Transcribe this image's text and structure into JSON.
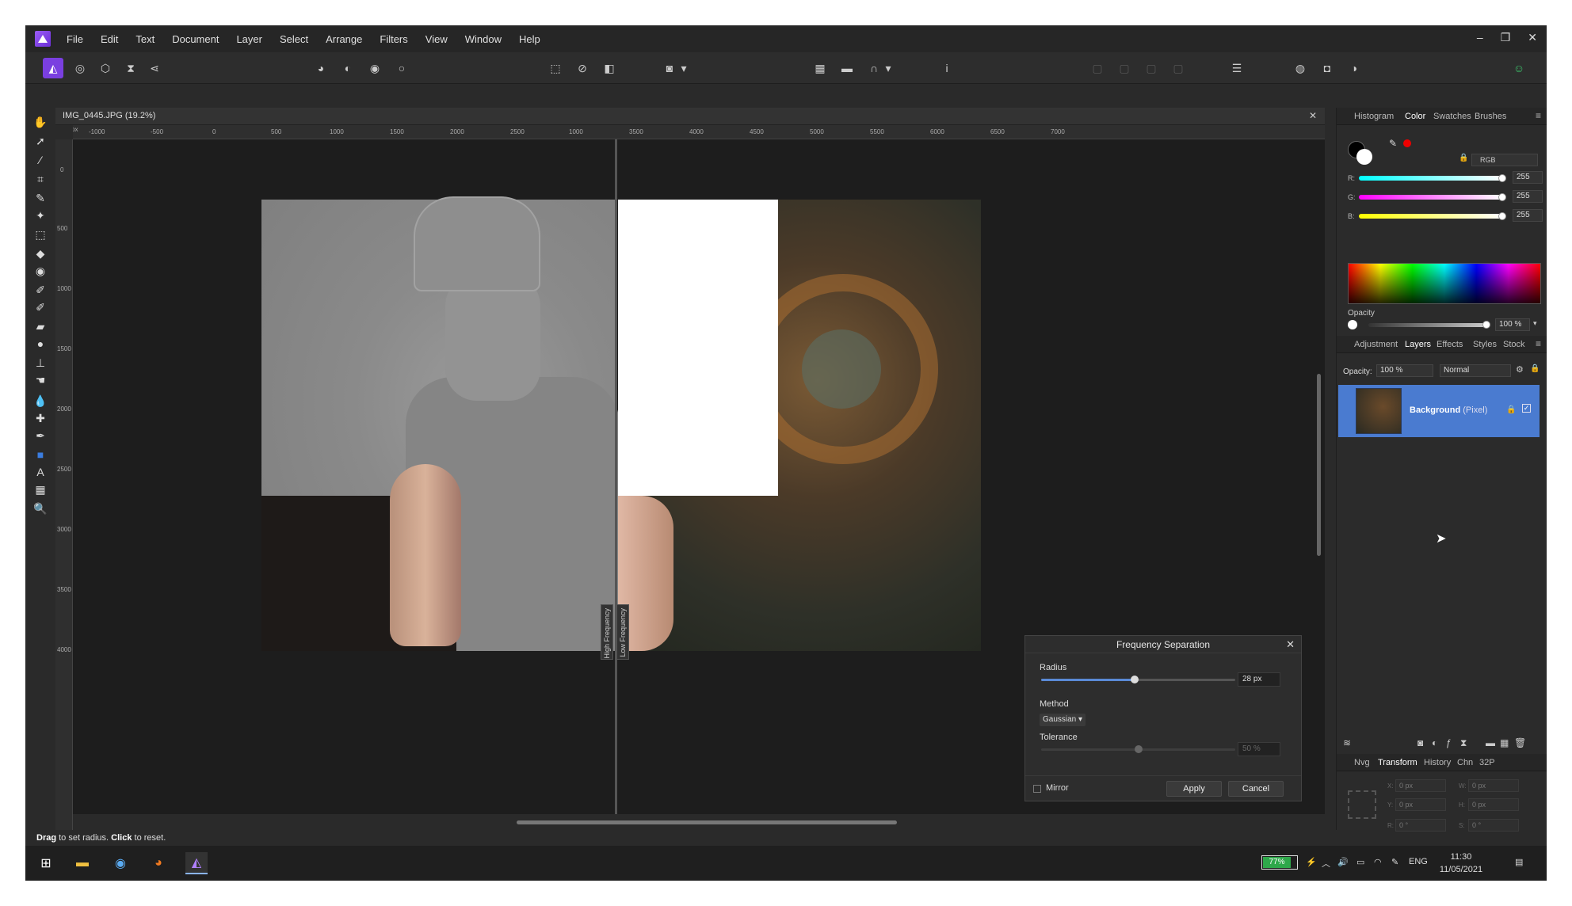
{
  "menu": {
    "items": [
      "File",
      "Edit",
      "Text",
      "Document",
      "Layer",
      "Select",
      "Arrange",
      "Filters",
      "View",
      "Window",
      "Help"
    ],
    "minimize": "–",
    "restore": "❐",
    "close": "✕"
  },
  "document": {
    "tab_title": "IMG_0445.JPG (19.2%)",
    "close": "✕",
    "ruler_unit": "px",
    "ruler_h_labels": [
      "-1000",
      "-500",
      "0",
      "500",
      "1000",
      "1500",
      "2000",
      "2500",
      "1000",
      "3500",
      "4000",
      "4500",
      "5000",
      "5500",
      "6000",
      "6500",
      "7000"
    ],
    "ruler_v_labels": [
      "0",
      "500",
      "1000",
      "1500",
      "2000",
      "2500",
      "3000",
      "3500",
      "4000"
    ],
    "split_left_label": "High Frequency",
    "split_right_label": "Low Frequency"
  },
  "dialog": {
    "title": "Frequency Separation",
    "close": "✕",
    "radius_label": "Radius",
    "radius_value": "28 px",
    "radius_fraction": 0.48,
    "method_label": "Method",
    "method_value": "Gaussian ▾",
    "tolerance_label": "Tolerance",
    "tolerance_value": "50 %",
    "tolerance_fraction": 0.5,
    "mirror_label": "Mirror",
    "apply_label": "Apply",
    "cancel_label": "Cancel"
  },
  "status": {
    "drag_word": "Drag",
    "drag_text": " to set radius. ",
    "click_word": "Click",
    "click_text": " to reset."
  },
  "color_panel": {
    "tabs": [
      "Histogram",
      "Color",
      "Swatches",
      "Brushes"
    ],
    "active_tab": "Color",
    "mode": "RGB",
    "r_label": "R:",
    "r_value": "255",
    "g_label": "G:",
    "g_value": "255",
    "b_label": "B:",
    "b_value": "255",
    "opacity_label": "Opacity",
    "opacity_value": "100 %"
  },
  "layers_panel": {
    "tabs": [
      "Adjustment",
      "Layers",
      "Effects",
      "Styles",
      "Stock"
    ],
    "active_tab": "Layers",
    "opacity_label": "Opacity:",
    "opacity_value": "100 %",
    "blend_mode": "Normal",
    "layer_name": "Background",
    "layer_type": " (Pixel)"
  },
  "transform_panel": {
    "tabs": [
      "Nvg",
      "Transform",
      "History",
      "Chn",
      "32P"
    ],
    "active_tab": "Transform",
    "x_label": "X:",
    "x_value": "0 px",
    "y_label": "Y:",
    "y_value": "0 px",
    "w_label": "W:",
    "w_value": "0 px",
    "h_label": "H:",
    "h_value": "0 px",
    "r_label": "R:",
    "r_value": "0 °",
    "s_label": "S:",
    "s_value": "0 °"
  },
  "taskbar": {
    "battery": "77%",
    "language": "ENG",
    "time": "11:30",
    "date": "11/05/2021"
  },
  "colors": {
    "accent": "#4a7bd0",
    "persona": "#7a3fe0",
    "battery": "#2ea84a"
  }
}
